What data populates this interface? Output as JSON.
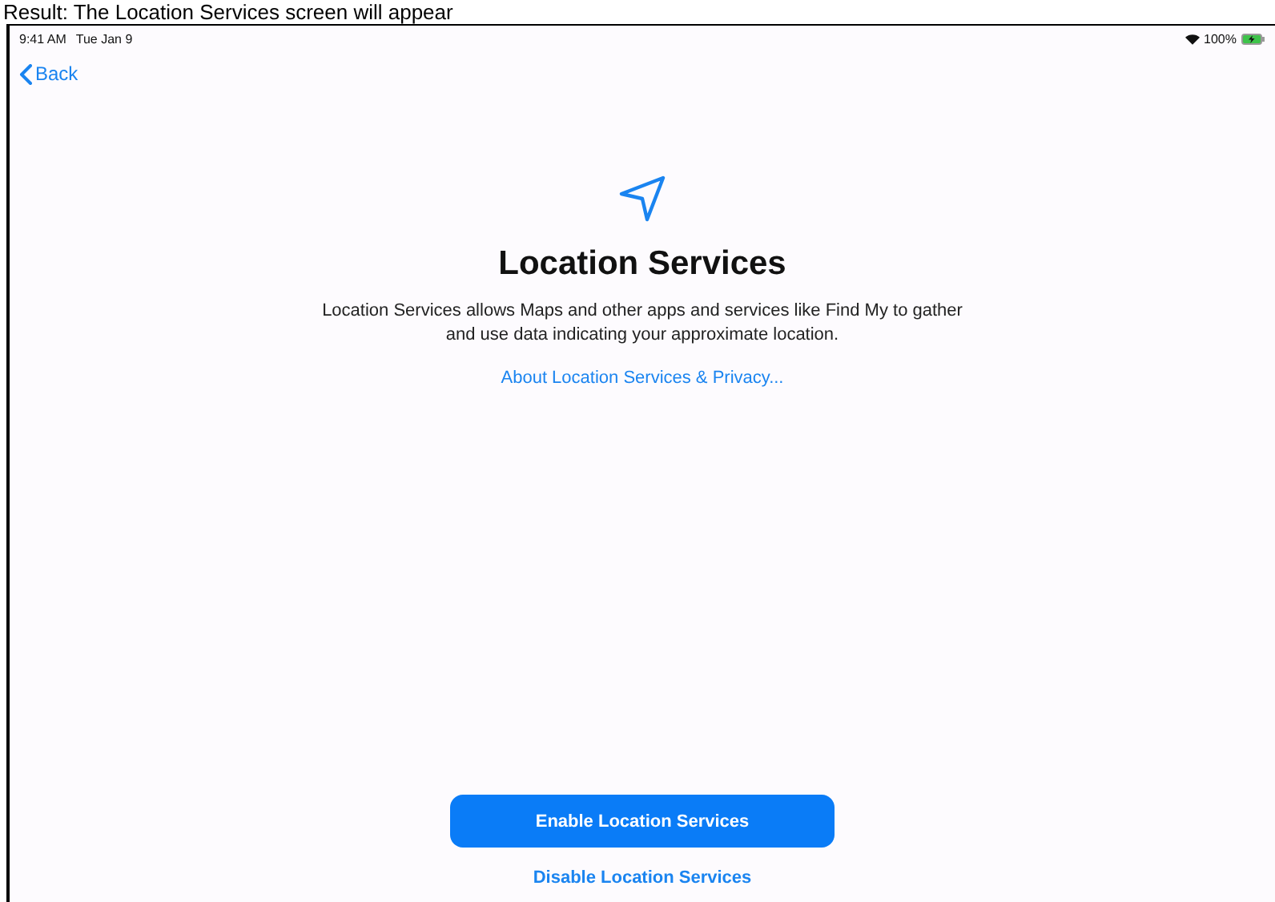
{
  "caption": "Result: The Location Services screen will appear",
  "status_bar": {
    "time": "9:41 AM",
    "date": "Tue Jan 9",
    "battery": "100%",
    "charging": true
  },
  "nav": {
    "back": "Back"
  },
  "title": "Location Services",
  "description": "Location Services allows Maps and other apps and services like Find My to gather and use data indicating your approximate location.",
  "link": "About Location Services & Privacy...",
  "buttons": [
    {
      "label": "Enable Location Services",
      "kind": "primary"
    },
    {
      "label": "Disable Location Services",
      "kind": "plain"
    }
  ]
}
